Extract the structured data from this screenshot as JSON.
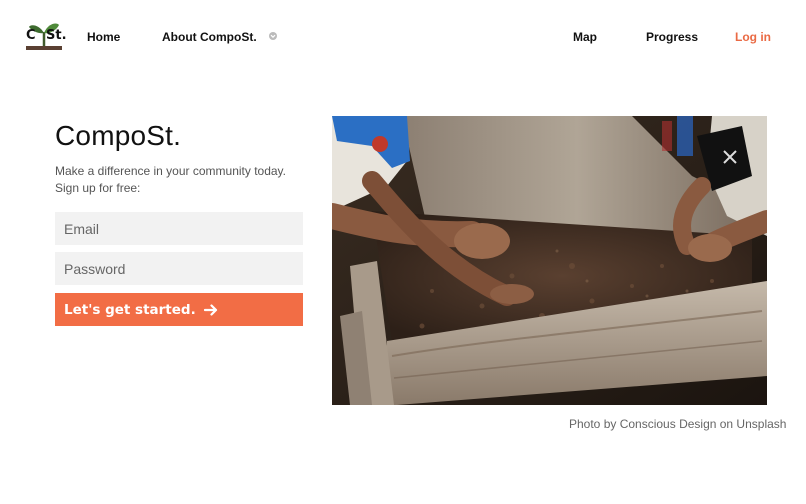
{
  "nav": {
    "logo_text_left": "C",
    "logo_text_right": "St.",
    "home": "Home",
    "about": "About CompoSt.",
    "about_caret_icon": "chevron-down-icon",
    "map": "Map",
    "progress": "Progress",
    "login": "Log in"
  },
  "hero": {
    "title": "CompoSt.",
    "subtitle": "Make a difference in your community today. Sign up for free:"
  },
  "form": {
    "email_placeholder": "Email",
    "password_placeholder": "Password",
    "submit_label": "Let's get started.",
    "submit_icon": "arrow-right-icon"
  },
  "photo": {
    "caption": "Photo by Conscious Design on Unsplash"
  },
  "colors": {
    "accent": "#f26d45",
    "login_link": "#ea6a44",
    "input_bg": "#f2f2f2"
  }
}
